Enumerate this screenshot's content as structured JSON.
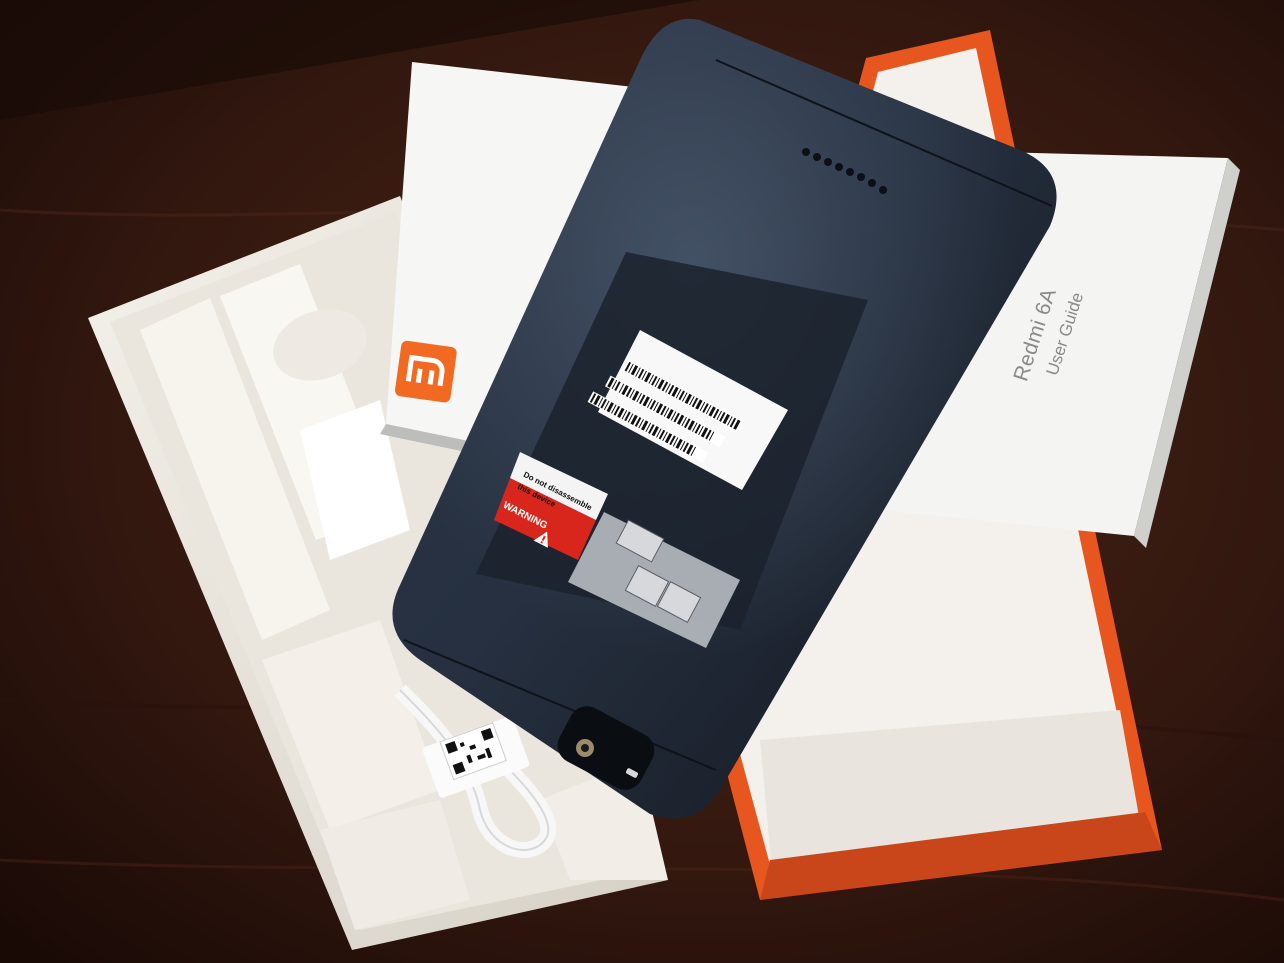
{
  "scene": {
    "description_free": true,
    "colors": {
      "table": "#3a1c14",
      "box_orange": "#e8561f",
      "box_inner": "#f1ede6",
      "phone_body": "#1f2733",
      "guide_paper": "#f4f4f2",
      "mi_logo": "#f26a21"
    }
  },
  "user_guide": {
    "title": "Redmi 6A",
    "subtitle": "User Guide"
  },
  "logo": {
    "text": "MI"
  },
  "warning_label": {
    "header": "WARNING",
    "line1": "Do not disassemble",
    "line2": "this device"
  },
  "icons": [
    "mi-logo-icon",
    "qr-code-icon",
    "barcode-icon",
    "warning-triangle-icon",
    "camera-icon",
    "flash-icon"
  ]
}
